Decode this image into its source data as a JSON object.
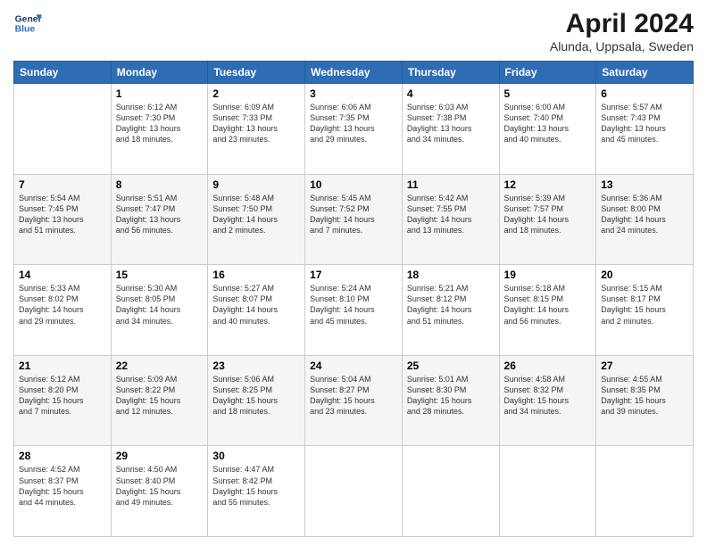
{
  "header": {
    "logo_line1": "General",
    "logo_line2": "Blue",
    "month_title": "April 2024",
    "location": "Alunda, Uppsala, Sweden"
  },
  "days_of_week": [
    "Sunday",
    "Monday",
    "Tuesday",
    "Wednesday",
    "Thursday",
    "Friday",
    "Saturday"
  ],
  "weeks": [
    [
      {
        "day": "",
        "info": ""
      },
      {
        "day": "1",
        "info": "Sunrise: 6:12 AM\nSunset: 7:30 PM\nDaylight: 13 hours\nand 18 minutes."
      },
      {
        "day": "2",
        "info": "Sunrise: 6:09 AM\nSunset: 7:33 PM\nDaylight: 13 hours\nand 23 minutes."
      },
      {
        "day": "3",
        "info": "Sunrise: 6:06 AM\nSunset: 7:35 PM\nDaylight: 13 hours\nand 29 minutes."
      },
      {
        "day": "4",
        "info": "Sunrise: 6:03 AM\nSunset: 7:38 PM\nDaylight: 13 hours\nand 34 minutes."
      },
      {
        "day": "5",
        "info": "Sunrise: 6:00 AM\nSunset: 7:40 PM\nDaylight: 13 hours\nand 40 minutes."
      },
      {
        "day": "6",
        "info": "Sunrise: 5:57 AM\nSunset: 7:43 PM\nDaylight: 13 hours\nand 45 minutes."
      }
    ],
    [
      {
        "day": "7",
        "info": "Sunrise: 5:54 AM\nSunset: 7:45 PM\nDaylight: 13 hours\nand 51 minutes."
      },
      {
        "day": "8",
        "info": "Sunrise: 5:51 AM\nSunset: 7:47 PM\nDaylight: 13 hours\nand 56 minutes."
      },
      {
        "day": "9",
        "info": "Sunrise: 5:48 AM\nSunset: 7:50 PM\nDaylight: 14 hours\nand 2 minutes."
      },
      {
        "day": "10",
        "info": "Sunrise: 5:45 AM\nSunset: 7:52 PM\nDaylight: 14 hours\nand 7 minutes."
      },
      {
        "day": "11",
        "info": "Sunrise: 5:42 AM\nSunset: 7:55 PM\nDaylight: 14 hours\nand 13 minutes."
      },
      {
        "day": "12",
        "info": "Sunrise: 5:39 AM\nSunset: 7:57 PM\nDaylight: 14 hours\nand 18 minutes."
      },
      {
        "day": "13",
        "info": "Sunrise: 5:36 AM\nSunset: 8:00 PM\nDaylight: 14 hours\nand 24 minutes."
      }
    ],
    [
      {
        "day": "14",
        "info": "Sunrise: 5:33 AM\nSunset: 8:02 PM\nDaylight: 14 hours\nand 29 minutes."
      },
      {
        "day": "15",
        "info": "Sunrise: 5:30 AM\nSunset: 8:05 PM\nDaylight: 14 hours\nand 34 minutes."
      },
      {
        "day": "16",
        "info": "Sunrise: 5:27 AM\nSunset: 8:07 PM\nDaylight: 14 hours\nand 40 minutes."
      },
      {
        "day": "17",
        "info": "Sunrise: 5:24 AM\nSunset: 8:10 PM\nDaylight: 14 hours\nand 45 minutes."
      },
      {
        "day": "18",
        "info": "Sunrise: 5:21 AM\nSunset: 8:12 PM\nDaylight: 14 hours\nand 51 minutes."
      },
      {
        "day": "19",
        "info": "Sunrise: 5:18 AM\nSunset: 8:15 PM\nDaylight: 14 hours\nand 56 minutes."
      },
      {
        "day": "20",
        "info": "Sunrise: 5:15 AM\nSunset: 8:17 PM\nDaylight: 15 hours\nand 2 minutes."
      }
    ],
    [
      {
        "day": "21",
        "info": "Sunrise: 5:12 AM\nSunset: 8:20 PM\nDaylight: 15 hours\nand 7 minutes."
      },
      {
        "day": "22",
        "info": "Sunrise: 5:09 AM\nSunset: 8:22 PM\nDaylight: 15 hours\nand 12 minutes."
      },
      {
        "day": "23",
        "info": "Sunrise: 5:06 AM\nSunset: 8:25 PM\nDaylight: 15 hours\nand 18 minutes."
      },
      {
        "day": "24",
        "info": "Sunrise: 5:04 AM\nSunset: 8:27 PM\nDaylight: 15 hours\nand 23 minutes."
      },
      {
        "day": "25",
        "info": "Sunrise: 5:01 AM\nSunset: 8:30 PM\nDaylight: 15 hours\nand 28 minutes."
      },
      {
        "day": "26",
        "info": "Sunrise: 4:58 AM\nSunset: 8:32 PM\nDaylight: 15 hours\nand 34 minutes."
      },
      {
        "day": "27",
        "info": "Sunrise: 4:55 AM\nSunset: 8:35 PM\nDaylight: 15 hours\nand 39 minutes."
      }
    ],
    [
      {
        "day": "28",
        "info": "Sunrise: 4:52 AM\nSunset: 8:37 PM\nDaylight: 15 hours\nand 44 minutes."
      },
      {
        "day": "29",
        "info": "Sunrise: 4:50 AM\nSunset: 8:40 PM\nDaylight: 15 hours\nand 49 minutes."
      },
      {
        "day": "30",
        "info": "Sunrise: 4:47 AM\nSunset: 8:42 PM\nDaylight: 15 hours\nand 55 minutes."
      },
      {
        "day": "",
        "info": ""
      },
      {
        "day": "",
        "info": ""
      },
      {
        "day": "",
        "info": ""
      },
      {
        "day": "",
        "info": ""
      }
    ]
  ]
}
